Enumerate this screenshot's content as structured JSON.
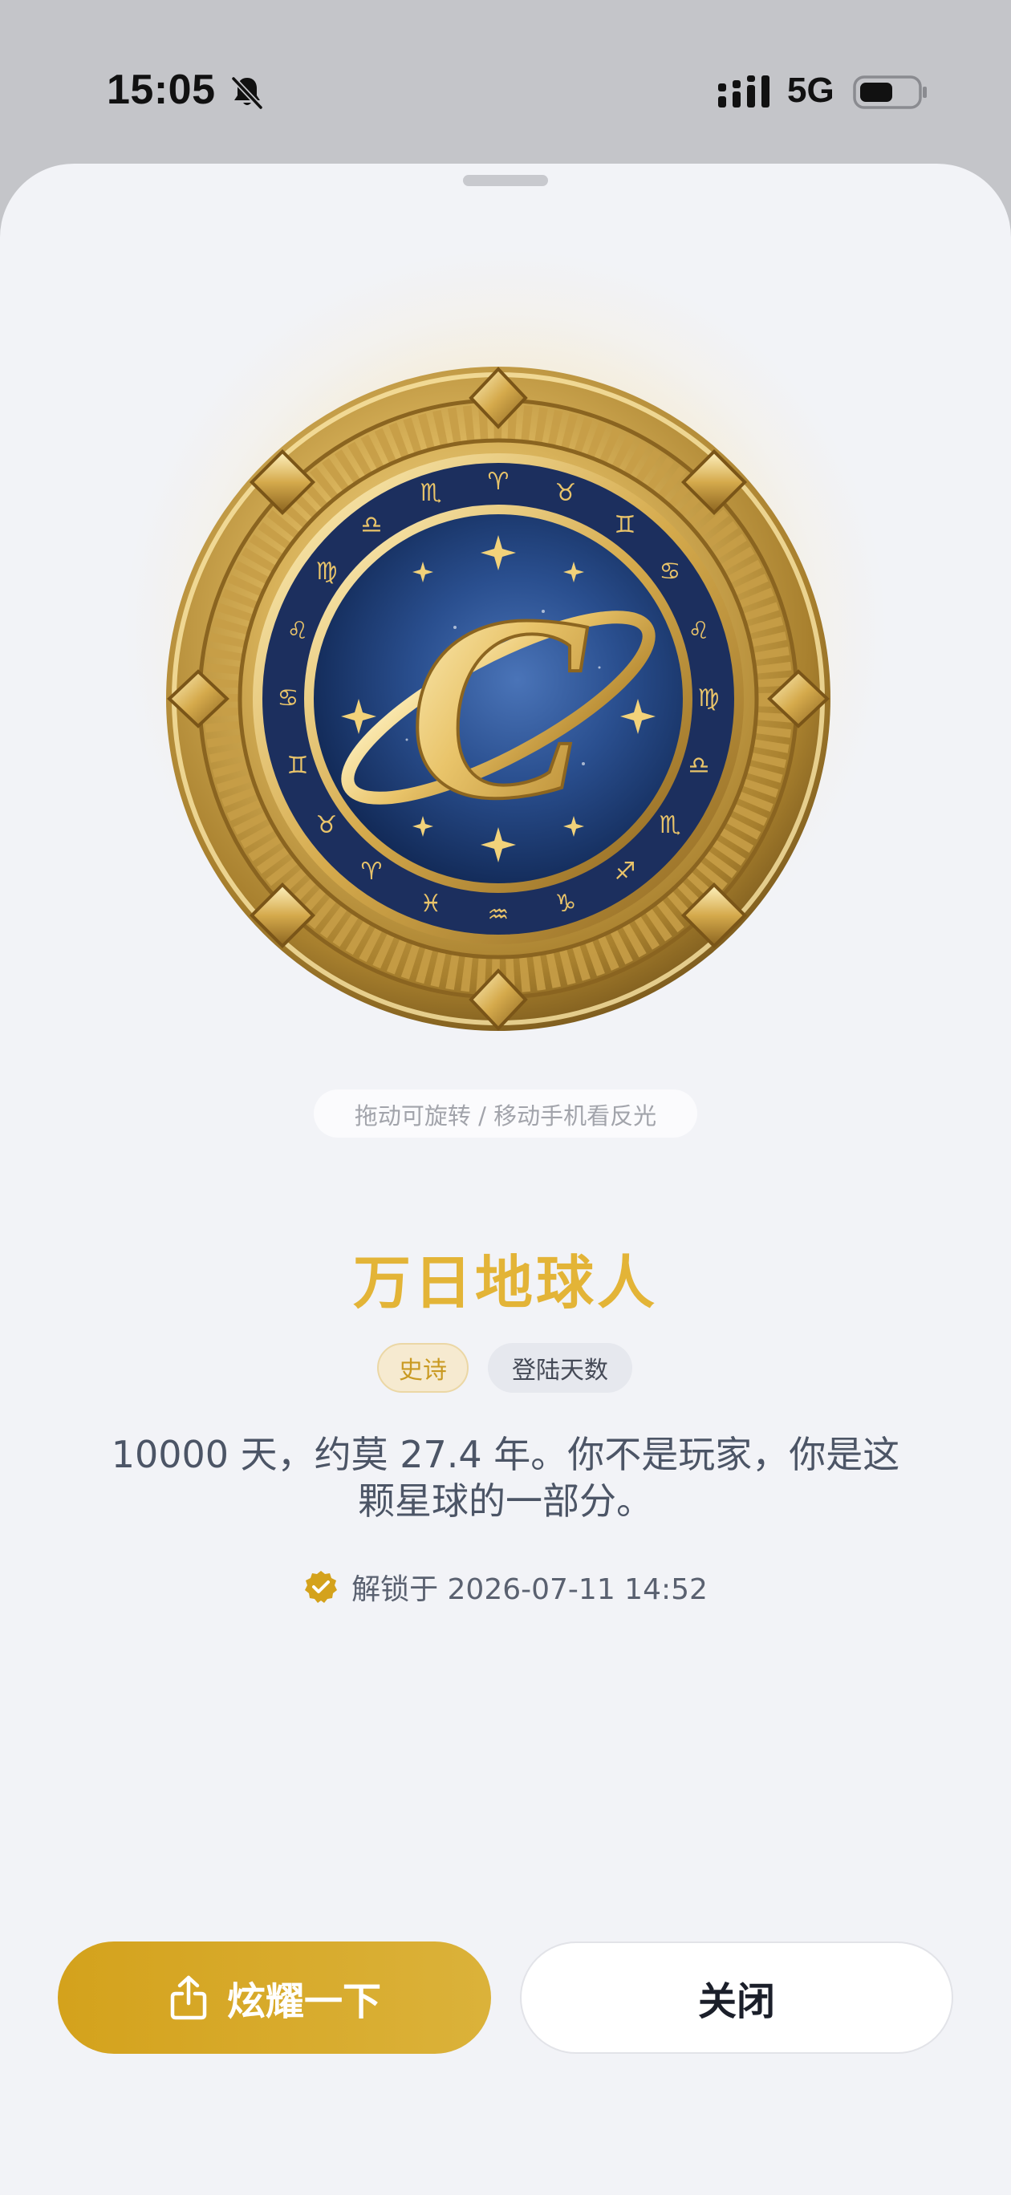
{
  "status_bar": {
    "time": "15:05",
    "network": "5G",
    "icons": [
      "bell-slash-icon",
      "signal-bars-icon",
      "battery-icon"
    ]
  },
  "medal": {
    "emblem_letter": "C",
    "icon": "planet-c-zodiac-coin"
  },
  "hint": "拖动可旋转 / 移动手机看反光",
  "title": "万日地球人",
  "tags": {
    "rarity": "史诗",
    "category": "登陆天数"
  },
  "description": "10000 天，约莫 27.4 年。你不是玩家，你是这颗星球的一部分。",
  "unlock": {
    "text": "解锁于 2026-07-11 14:52",
    "icon": "verified-check-icon"
  },
  "buttons": {
    "share_label": "炫耀一下",
    "close_label": "关闭"
  },
  "colors": {
    "gold": "#e3b437",
    "button_gold": "#d4a21c",
    "sheet_bg": "#f2f3f7",
    "medal_blue": "#1f3a73"
  }
}
